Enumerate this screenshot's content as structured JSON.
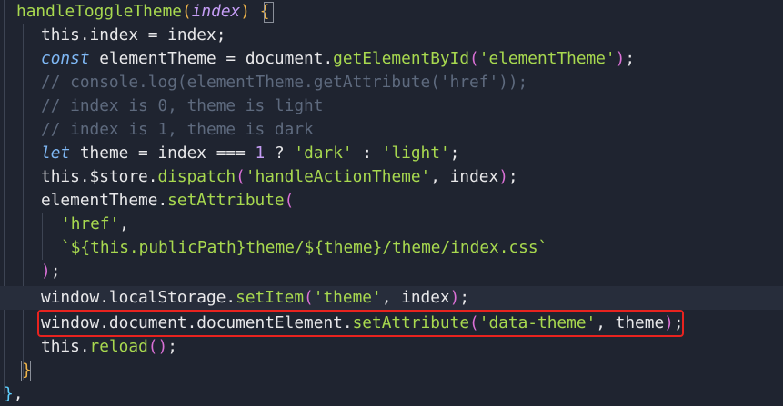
{
  "editor": {
    "lines": [
      {
        "id": "l1",
        "tokens": [
          {
            "t": "handleToggleTheme",
            "c": "func"
          },
          {
            "t": "(",
            "c": "paren"
          },
          {
            "t": "index",
            "c": "param"
          },
          {
            "t": ")",
            "c": "paren"
          },
          {
            "t": " ",
            "c": "plain"
          },
          {
            "t": "{",
            "c": "brace"
          }
        ]
      },
      {
        "id": "l2",
        "tokens": [
          {
            "t": "this",
            "c": "plain"
          },
          {
            "t": ".index = index;",
            "c": "plain"
          }
        ]
      },
      {
        "id": "l3",
        "tokens": [
          {
            "t": "const",
            "c": "keyword"
          },
          {
            "t": " elementTheme = document.",
            "c": "plain"
          },
          {
            "t": "getElementById",
            "c": "method"
          },
          {
            "t": "(",
            "c": "paren2"
          },
          {
            "t": "'elementTheme'",
            "c": "string"
          },
          {
            "t": ")",
            "c": "paren2"
          },
          {
            "t": ";",
            "c": "plain"
          }
        ]
      },
      {
        "id": "l4",
        "tokens": [
          {
            "t": "// console.log(elementTheme.getAttribute('href'));",
            "c": "comment"
          }
        ]
      },
      {
        "id": "l5",
        "tokens": [
          {
            "t": "// index is 0, theme is light",
            "c": "comment"
          }
        ]
      },
      {
        "id": "l6",
        "tokens": [
          {
            "t": "// index is 1, theme is dark",
            "c": "comment"
          }
        ]
      },
      {
        "id": "l7",
        "tokens": [
          {
            "t": "let",
            "c": "keyword"
          },
          {
            "t": " theme = index === ",
            "c": "plain"
          },
          {
            "t": "1",
            "c": "number"
          },
          {
            "t": " ? ",
            "c": "plain"
          },
          {
            "t": "'dark'",
            "c": "string"
          },
          {
            "t": " : ",
            "c": "plain"
          },
          {
            "t": "'light'",
            "c": "string"
          },
          {
            "t": ";",
            "c": "plain"
          }
        ]
      },
      {
        "id": "l8",
        "tokens": [
          {
            "t": "this",
            "c": "plain"
          },
          {
            "t": ".$store.",
            "c": "plain"
          },
          {
            "t": "dispatch",
            "c": "method"
          },
          {
            "t": "(",
            "c": "paren2"
          },
          {
            "t": "'handleActionTheme'",
            "c": "string"
          },
          {
            "t": ", index",
            "c": "plain"
          },
          {
            "t": ")",
            "c": "paren2"
          },
          {
            "t": ";",
            "c": "plain"
          }
        ]
      },
      {
        "id": "l9",
        "tokens": [
          {
            "t": "elementTheme.",
            "c": "plain"
          },
          {
            "t": "setAttribute",
            "c": "method"
          },
          {
            "t": "(",
            "c": "paren2"
          }
        ]
      },
      {
        "id": "l10",
        "tokens": [
          {
            "t": "'href'",
            "c": "string"
          },
          {
            "t": ",",
            "c": "plain"
          }
        ]
      },
      {
        "id": "l11",
        "tokens": [
          {
            "t": "`${this.publicPath}theme/${theme}/theme/index.css`",
            "c": "string"
          }
        ]
      },
      {
        "id": "l12",
        "tokens": [
          {
            "t": ")",
            "c": "paren2"
          },
          {
            "t": ";",
            "c": "plain"
          }
        ]
      },
      {
        "id": "l13",
        "tokens": [
          {
            "t": "window.localStorage.",
            "c": "plain"
          },
          {
            "t": "setItem",
            "c": "method"
          },
          {
            "t": "(",
            "c": "paren2"
          },
          {
            "t": "'theme'",
            "c": "string"
          },
          {
            "t": ", index",
            "c": "plain"
          },
          {
            "t": ")",
            "c": "paren2"
          },
          {
            "t": ";",
            "c": "plain"
          }
        ]
      },
      {
        "id": "l14",
        "tokens": [
          {
            "t": "window.document.documentElement.",
            "c": "plain"
          },
          {
            "t": "setAttribute",
            "c": "method"
          },
          {
            "t": "(",
            "c": "paren2"
          },
          {
            "t": "'data-theme'",
            "c": "string"
          },
          {
            "t": ", theme",
            "c": "plain"
          },
          {
            "t": ")",
            "c": "paren2"
          },
          {
            "t": ";",
            "c": "plain"
          }
        ]
      },
      {
        "id": "l15",
        "tokens": [
          {
            "t": "this",
            "c": "plain"
          },
          {
            "t": ".",
            "c": "plain"
          },
          {
            "t": "reload",
            "c": "method"
          },
          {
            "t": "(",
            "c": "paren2"
          },
          {
            "t": ")",
            "c": "paren2"
          },
          {
            "t": ";",
            "c": "plain"
          }
        ]
      },
      {
        "id": "l16",
        "tokens": [
          {
            "t": "}",
            "c": "brace"
          }
        ]
      },
      {
        "id": "l17",
        "tokens": [
          {
            "t": "}",
            "c": "brace2"
          },
          {
            "t": ",",
            "c": "plain"
          }
        ]
      }
    ]
  },
  "colors": {
    "background": "#1f2430",
    "highlight_box": "#e8231f"
  }
}
